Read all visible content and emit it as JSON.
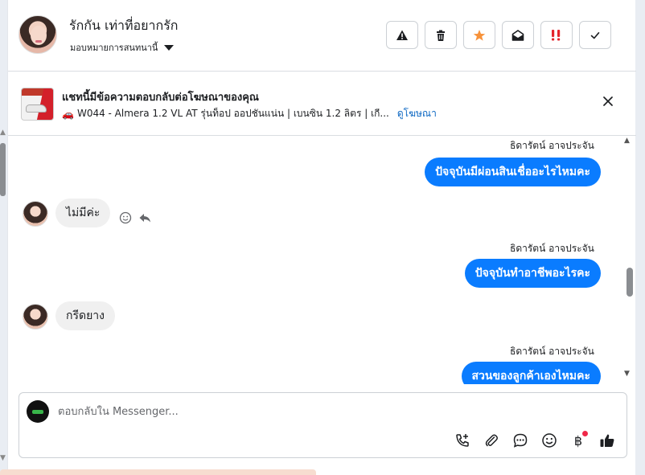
{
  "header": {
    "contact_name": "รักกัน เท่าที่อยากรัก",
    "assign_label": "มอบหมายการสนทนานี้",
    "actions": [
      {
        "name": "report-spam",
        "icon": "warning-icon"
      },
      {
        "name": "delete",
        "icon": "trash-icon"
      },
      {
        "name": "star",
        "icon": "star-icon"
      },
      {
        "name": "mark-unread",
        "icon": "envelope-open-icon"
      },
      {
        "name": "important",
        "icon": "important-icon"
      },
      {
        "name": "mark-done",
        "icon": "check-icon"
      }
    ]
  },
  "ad": {
    "title": "แชทนี้มีข้อความตอบกลับต่อโฆษณาของคุณ",
    "emoji": "🚗",
    "description": "W044 - Almera 1.2 VL AT รุ่นท็อป ออปชันแน่น | เบนซิน 1.2 ลิตร | เกี...",
    "link": "ดูโฆษณา"
  },
  "messages": [
    {
      "direction": "out",
      "sender": "ธิดารัตน์ อาจประจัน",
      "text": "ปัจจุบันมีผ่อนสินเชื่ออะไรไหมคะ"
    },
    {
      "direction": "in",
      "text": "ไม่มีค่ะ"
    },
    {
      "direction": "out",
      "sender": "ธิดารัตน์ อาจประจัน",
      "text": "ปัจจุบันทำอาชีพอะไรคะ"
    },
    {
      "direction": "in",
      "text": "กรีดยาง"
    },
    {
      "direction": "out",
      "sender": "ธิดารัตน์ อาจประจัน",
      "text": "สวนของลูกค้าเองไหมคะ"
    }
  ],
  "composer": {
    "placeholder": "ตอบกลับใน Messenger...",
    "baht_symbol": "฿"
  },
  "colors": {
    "accent": "#0a7cff",
    "incoming_bubble": "#f0f0f0",
    "notification_dot": "#f02849",
    "star": "#f7923a",
    "important": "#e4252c"
  }
}
